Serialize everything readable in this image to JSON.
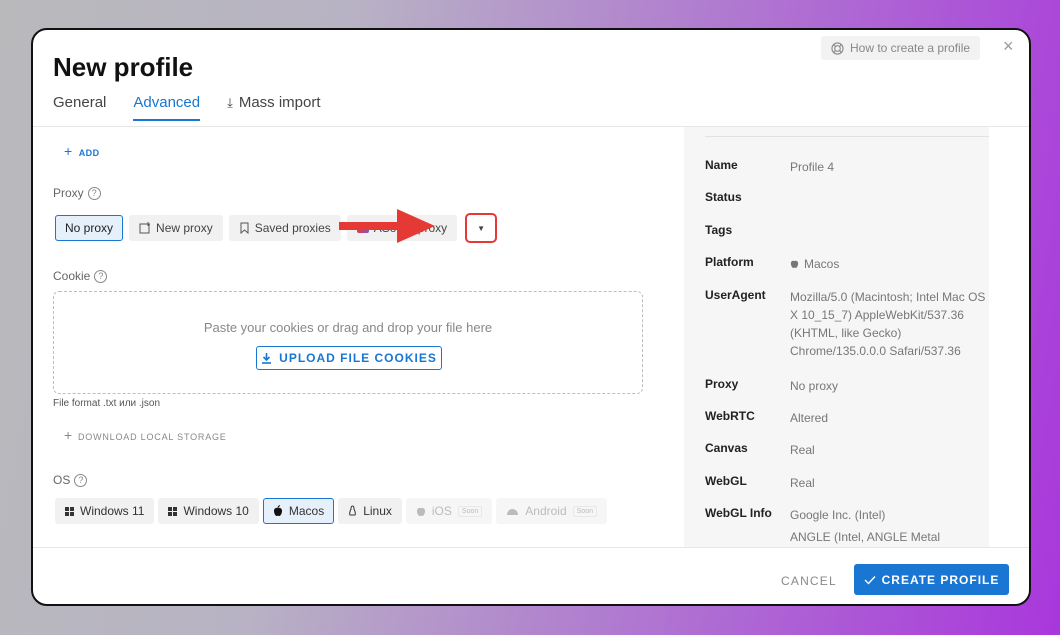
{
  "dialog": {
    "title": "New profile",
    "help_label": "How to create a profile",
    "close_glyph": "×"
  },
  "tabs": [
    {
      "label": "General"
    },
    {
      "label": "Advanced"
    },
    {
      "label": "Mass import"
    }
  ],
  "add_label": "ADD",
  "proxy": {
    "label": "Proxy",
    "options": [
      {
        "label": "No proxy",
        "icon": "none"
      },
      {
        "label": "New proxy",
        "icon": "new-proxy-icon"
      },
      {
        "label": "Saved proxies",
        "icon": "bookmark-icon"
      },
      {
        "label": "ASocks proxy",
        "icon": "asocks-logo-icon"
      }
    ],
    "dropdown_glyph": "▼"
  },
  "cookie": {
    "label": "Cookie",
    "dropzone_text": "Paste your cookies or drag and drop your file here",
    "upload_label": "UPLOAD FILE COOKIES",
    "format_note": "File format .txt или .json",
    "download_local_label": "DOWNLOAD LOCAL STORAGE"
  },
  "os": {
    "label": "OS",
    "options": [
      {
        "label": "Windows 11"
      },
      {
        "label": "Windows 10"
      },
      {
        "label": "Macos"
      },
      {
        "label": "Linux"
      },
      {
        "label": "iOS",
        "badge": "Soon"
      },
      {
        "label": "Android",
        "badge": "Soon"
      }
    ]
  },
  "summary": [
    {
      "key": "Name",
      "value": "Profile 4"
    },
    {
      "key": "Status",
      "value": ""
    },
    {
      "key": "Tags",
      "value": ""
    },
    {
      "key": "Platform",
      "value": "Macos"
    },
    {
      "key": "UserAgent",
      "value": "Mozilla/5.0 (Macintosh; Intel Mac OS X 10_15_7) AppleWebKit/537.36 (KHTML, like Gecko) Chrome/135.0.0.0 Safari/537.36"
    },
    {
      "key": "Proxy",
      "value": "No proxy"
    },
    {
      "key": "WebRTC",
      "value": "Altered"
    },
    {
      "key": "Canvas",
      "value": "Real"
    },
    {
      "key": "WebGL",
      "value": "Real"
    },
    {
      "key": "WebGL Info",
      "value": "Google Inc. (Intel)",
      "value2": "ANGLE (Intel, ANGLE Metal"
    }
  ],
  "footer": {
    "cancel_label": "CANCEL",
    "create_label": "CREATE PROFILE"
  },
  "colors": {
    "accent": "#1976d2",
    "highlight": "#e53935"
  }
}
